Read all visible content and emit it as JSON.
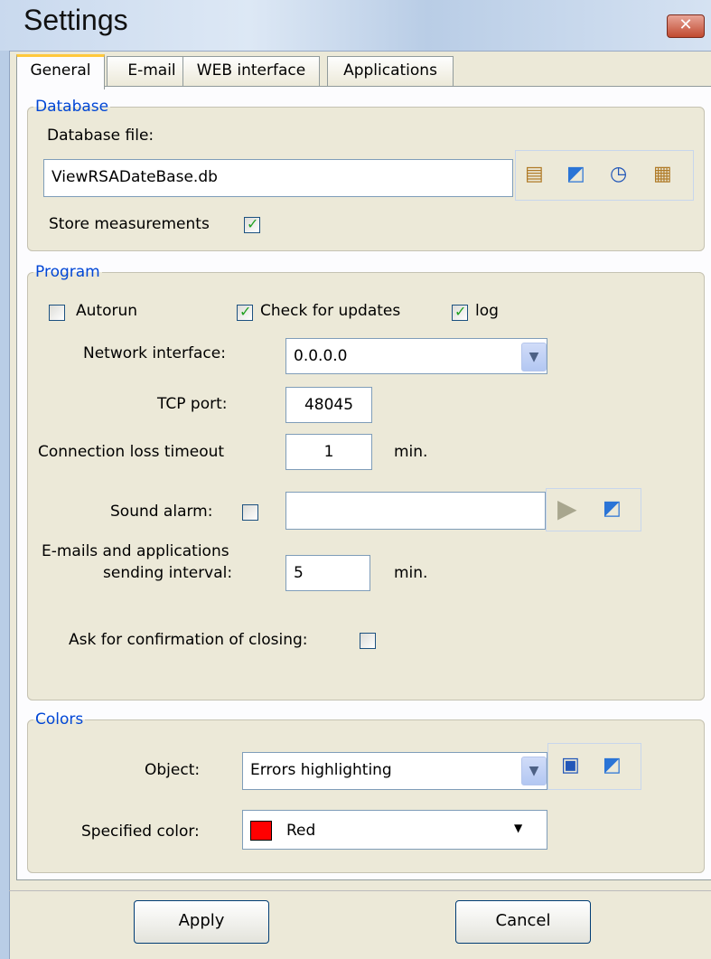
{
  "window": {
    "title": "Settings",
    "close_glyph": "✕"
  },
  "tabs": [
    {
      "label": "General",
      "active": true
    },
    {
      "label": "E-mail"
    },
    {
      "label": "WEB interface"
    },
    {
      "label": "Applications"
    }
  ],
  "database": {
    "legend": "Database",
    "file_label": "Database file:",
    "file_value": "ViewRSADateBase.db",
    "store_label": "Store measurements",
    "store_checked": true,
    "toolbar_icons": [
      "database-settings-icon",
      "open-folder-icon",
      "clock-icon",
      "database-tools-icon"
    ]
  },
  "program": {
    "legend": "Program",
    "autorun_label": "Autorun",
    "autorun_checked": false,
    "updates_label": "Check for updates",
    "updates_checked": true,
    "log_label": "log",
    "log_checked": true,
    "network_label": "Network interface:",
    "network_value": "0.0.0.0",
    "tcp_label": "TCP port:",
    "tcp_value": "48045",
    "timeout_label": "Connection loss timeout",
    "timeout_value": "1",
    "timeout_unit": "min.",
    "sound_label": "Sound alarm:",
    "sound_checked": false,
    "sound_value": "",
    "interval_label_line1": "E-mails and applications",
    "interval_label_line2": "sending interval:",
    "interval_value": "5",
    "interval_unit": "min.",
    "confirm_label": "Ask for confirmation of closing:",
    "confirm_checked": false
  },
  "colors": {
    "legend": "Colors",
    "object_label": "Object:",
    "object_value": "Errors highlighting",
    "specified_label": "Specified color:",
    "specified_value": "Red",
    "specified_swatch": "#ff0000"
  },
  "buttons": {
    "apply": "Apply",
    "cancel": "Cancel"
  }
}
